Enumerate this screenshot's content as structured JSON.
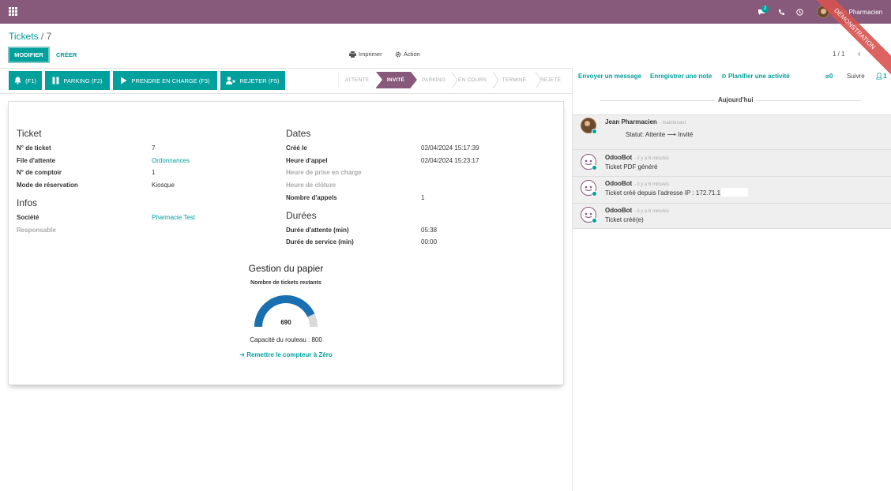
{
  "topbar": {
    "chat_badge": "2",
    "user_name": "Jean Pharmacien",
    "ribbon_text": "DEMONSTRATION"
  },
  "breadcrumb": {
    "parent": "Tickets",
    "separator": "/",
    "current": "7"
  },
  "toolbar": {
    "edit_label": "MODIFIER",
    "create_label": "CRÉER",
    "print_label": "Imprimer",
    "action_label": "Action",
    "pager": "1 / 1"
  },
  "actions": [
    {
      "label": "(F1)",
      "icon": "bell-icon"
    },
    {
      "label": "PARKING (F2)",
      "icon": "pause-icon"
    },
    {
      "label": "PRENDRE EN CHARGE (F3)",
      "icon": "play-icon"
    },
    {
      "label": "REJETER (F5)",
      "icon": "user-remove-icon"
    }
  ],
  "statusbar": [
    "ATTENTE",
    "INVITÉ",
    "PARKING",
    "EN COURS",
    "TERMINÉ",
    "REJETÉ"
  ],
  "statusbar_active": "INVITÉ",
  "form": {
    "ticket": {
      "title": "Ticket",
      "fields": [
        {
          "label": "N° de ticket",
          "value": "7"
        },
        {
          "label": "File d'attente",
          "value": "Ordonnances"
        },
        {
          "label": "N° de comptoir",
          "value": "1"
        },
        {
          "label": "Mode de réservation",
          "value": "Kiosque"
        }
      ]
    },
    "infos": {
      "title": "Infos",
      "fields": [
        {
          "label": "Société",
          "value": "Pharmacie Test"
        },
        {
          "label": "Responsable",
          "value": ""
        }
      ]
    },
    "dates": {
      "title": "Dates",
      "fields": [
        {
          "label": "Créé le",
          "value": "02/04/2024 15:17:39"
        },
        {
          "label": "Heure d'appel",
          "value": "02/04/2024 15:23:17"
        },
        {
          "label": "Heure de prise en charge",
          "value": ""
        },
        {
          "label": "Heure de clôture",
          "value": ""
        },
        {
          "label": "Nombre d'appels",
          "value": "1"
        }
      ]
    },
    "durees": {
      "title": "Durées",
      "fields": [
        {
          "label": "Durée d'attente (min)",
          "value": "05:38"
        },
        {
          "label": "Durée de service (min)",
          "value": "00:00"
        }
      ]
    },
    "paper": {
      "title": "Gestion du papier",
      "subtitle": "Nombre de tickets restants",
      "value": "690",
      "remaining": 690,
      "capacity": 800,
      "capacity_label": "Capacité du rouleau : 800",
      "reset_label": "Remettre le compteur à Zéro"
    }
  },
  "chatter": {
    "send_message": "Envoyer un message",
    "log_note": "Enregistrer une note",
    "schedule": "Planifier une activité",
    "attachments": "0",
    "follow": "Suivre",
    "followers": "1",
    "today": "Aujourd'hui",
    "messages": [
      {
        "author": "Jean Pharmacien",
        "time": "- maintenant",
        "body": "Statut: Attente ⟶ Invité"
      },
      {
        "author": "OdooBot",
        "time": "- il y a 6 minutes",
        "body": "Ticket PDF généré"
      },
      {
        "author": "OdooBot",
        "time": "- il y a 6 minutes",
        "body": "Ticket créé depuis l'adresse IP : 172.71.1"
      },
      {
        "author": "OdooBot",
        "time": "- il y a 6 minutes",
        "body": "Ticket créé(e)"
      }
    ]
  },
  "colors": {
    "primary": "#00a09d",
    "brand": "#875a7b",
    "ribbon": "#d9534f"
  }
}
